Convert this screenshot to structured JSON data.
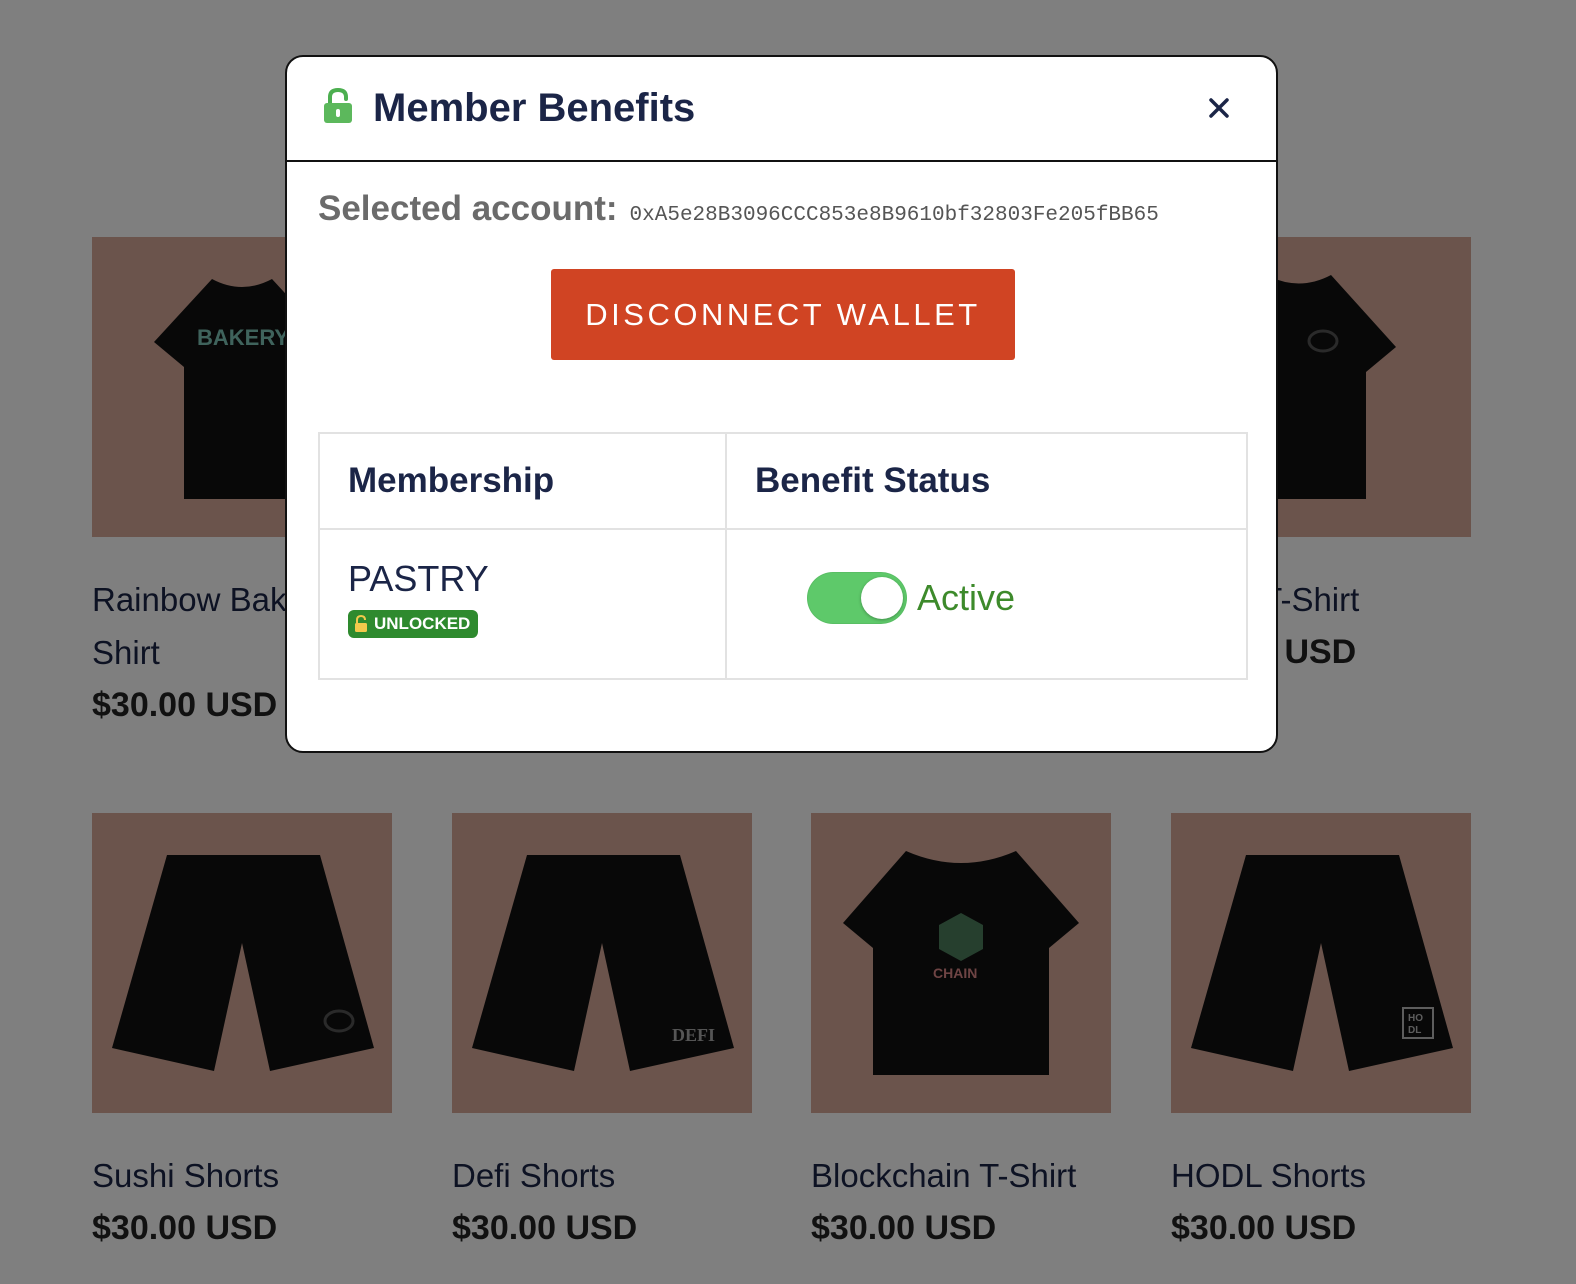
{
  "products": [
    {
      "id": "card-1",
      "title": "Rainbow Bakery T-Shirt",
      "price": "$30.00 USD",
      "icon": "bakery-tshirt-image"
    },
    {
      "id": "card-4",
      "title": "Sushi T-Shirt",
      "price": "$30.00 USD",
      "icon": "sushi-tshirt-image"
    },
    {
      "id": "card-5",
      "title": "Sushi Shorts",
      "price": "$30.00 USD",
      "icon": "sushi-shorts-image"
    },
    {
      "id": "card-6",
      "title": "Defi Shorts",
      "price": "$30.00 USD",
      "icon": "defi-shorts-image"
    },
    {
      "id": "card-7",
      "title": "Blockchain T-Shirt",
      "price": "$30.00 USD",
      "icon": "blockchain-tshirt-image"
    },
    {
      "id": "card-8",
      "title": "HODL Shorts",
      "price": "$30.00 USD",
      "icon": "hodl-shorts-image"
    }
  ],
  "print_text": {
    "bakery": "BAKERY",
    "defi": "DEFI",
    "chain": "CHAIN",
    "hodl_1": "HO",
    "hodl_2": "DL"
  },
  "modal": {
    "title": "Member Benefits",
    "title_icon": "green-lock-icon",
    "close_icon": "close-icon",
    "account_label": "Selected account:",
    "account_value": "0xA5e28B3096CCC853e8B9610bf32803Fe205fBB65",
    "disconnect_label": "DISCONNECT WALLET",
    "table": {
      "headers": [
        "Membership",
        "Benefit Status"
      ],
      "rows": [
        {
          "membership": "PASTRY",
          "badge": "UNLOCKED",
          "status": "Active",
          "toggle_on": true
        }
      ]
    }
  },
  "colors": {
    "overlay": "rgba(0,0,0,0.5)",
    "button": "#d04423",
    "toggle_on": "#5ec96a",
    "status_text": "#3d8a2b",
    "badge": "#2e8a2e",
    "product_bg": "#d6a898"
  }
}
